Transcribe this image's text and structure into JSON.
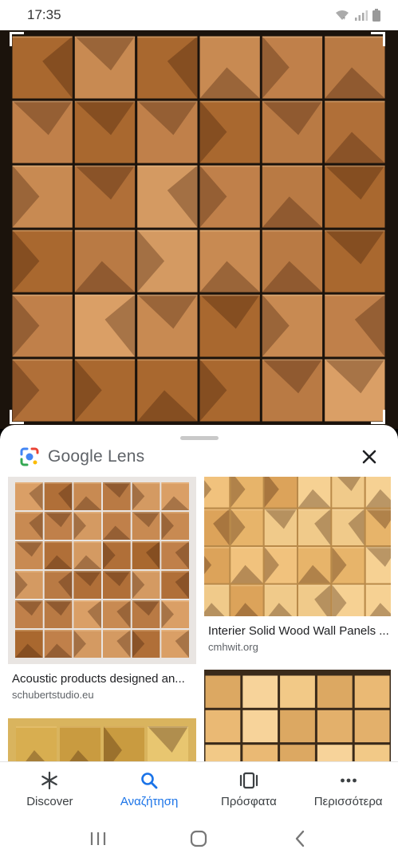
{
  "status_bar": {
    "time": "17:35"
  },
  "lens": {
    "brand": "Google Lens"
  },
  "results": [
    {
      "title": "Acoustic products designed an...",
      "source": "schubertstudio.eu"
    },
    {
      "title": "Interier Solid Wood Wall Panels ...",
      "source": "cmhwit.org"
    },
    {
      "title": "",
      "source": ""
    },
    {
      "title": "",
      "source": ""
    }
  ],
  "bottom_nav": {
    "items": [
      {
        "label": "Discover",
        "icon": "asterisk-icon"
      },
      {
        "label": "Αναζήτηση",
        "icon": "search-icon",
        "active": true
      },
      {
        "label": "Πρόσφατα",
        "icon": "recent-icon"
      },
      {
        "label": "Περισσότερα",
        "icon": "more-icon"
      }
    ]
  },
  "colors": {
    "accent": "#1a73e8",
    "wood_light": "#c98a52",
    "wood_dark": "#8a4e22"
  }
}
